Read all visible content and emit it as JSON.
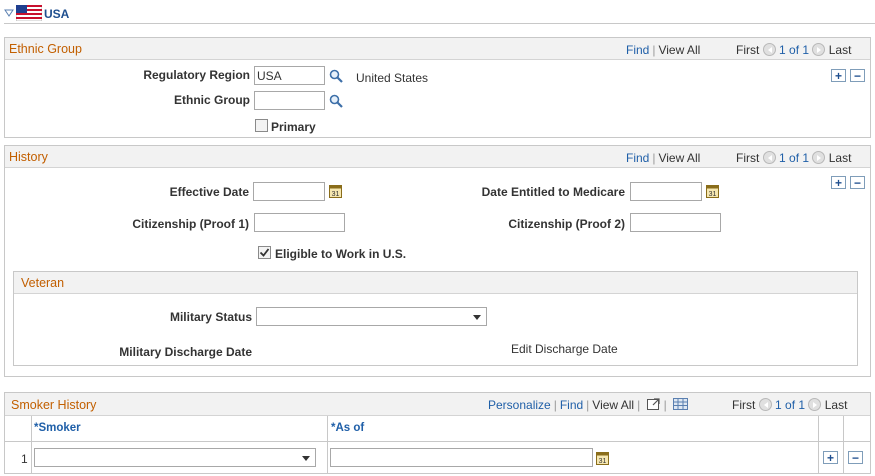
{
  "country": {
    "title": "USA"
  },
  "nav": {
    "find": "Find",
    "view_all": "View All",
    "first": "First",
    "range": "1 of 1",
    "last": "Last",
    "personalize": "Personalize"
  },
  "ethnic_group": {
    "title": "Ethnic Group",
    "regulatory_region_label": "Regulatory Region",
    "regulatory_region_value": "USA",
    "regulatory_region_desc": "United States",
    "ethnic_group_label": "Ethnic Group",
    "ethnic_group_value": "",
    "primary_label": "Primary",
    "primary_checked": false
  },
  "history": {
    "title": "History",
    "effective_date_label": "Effective Date",
    "effective_date_value": "",
    "medicare_label": "Date Entitled to Medicare",
    "medicare_value": "",
    "citizenship1_label": "Citizenship (Proof 1)",
    "citizenship1_value": "",
    "citizenship2_label": "Citizenship (Proof 2)",
    "citizenship2_value": "",
    "eligible_label": "Eligible to Work in U.S.",
    "eligible_checked": true
  },
  "veteran": {
    "title": "Veteran",
    "military_status_label": "Military Status",
    "military_status_value": "",
    "discharge_date_label": "Military Discharge Date",
    "edit_discharge_link": "Edit Discharge Date"
  },
  "smoker_history": {
    "title": "Smoker History",
    "columns": [
      "*Smoker",
      "*As of"
    ],
    "rows": [
      {
        "num": "1",
        "smoker": "",
        "as_of": ""
      }
    ]
  },
  "colors": {
    "section_title": "#c25f00",
    "link": "#1f5fa8",
    "header_bg": "#f2f2f2"
  }
}
